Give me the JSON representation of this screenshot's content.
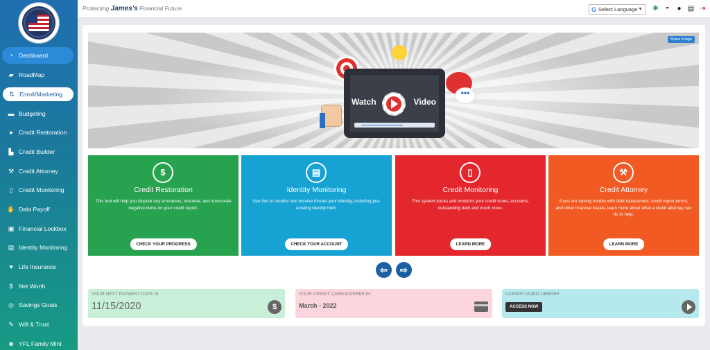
{
  "header": {
    "tagline_pre": "Protecting",
    "user_name": "James's",
    "tagline_post": "Financial Future.",
    "language_select": "Select Language"
  },
  "sidebar": {
    "items": [
      {
        "label": "Dashboard",
        "icon": "speedometer-icon"
      },
      {
        "label": "RoadMap",
        "icon": "car-icon"
      },
      {
        "label": "Enroll/Marketing",
        "icon": "share-icon"
      },
      {
        "label": "Budgeting",
        "icon": "wallet-icon"
      },
      {
        "label": "Credit Restoration",
        "icon": "money-hand-icon"
      },
      {
        "label": "Credit Builder",
        "icon": "building-icon"
      },
      {
        "label": "Credit Attorney",
        "icon": "gavel-icon"
      },
      {
        "label": "Credit Monitoring",
        "icon": "mobile-icon"
      },
      {
        "label": "Debt Payoff",
        "icon": "hand-cash-icon"
      },
      {
        "label": "Financial Lockbox",
        "icon": "lockbox-icon"
      },
      {
        "label": "Identity Monitoring",
        "icon": "id-card-icon"
      },
      {
        "label": "Life Insurance",
        "icon": "heart-pulse-icon"
      },
      {
        "label": "Net Worth",
        "icon": "money-bag-icon"
      },
      {
        "label": "Savings Goals",
        "icon": "coins-icon"
      },
      {
        "label": "Will & Trust",
        "icon": "handshake-icon"
      },
      {
        "label": "YFL Family Mint",
        "icon": "family-icon"
      }
    ]
  },
  "banner": {
    "share_label": "Share Image",
    "watch_text": "Watch",
    "video_text": "Video"
  },
  "cards": [
    {
      "title": "Credit Restoration",
      "desc": "This tool will help you dispute any erroneous, obsolete, and inaccurate negative items on your credit report.",
      "button": "CHECK YOUR PROGRESS",
      "color": "#27a24f",
      "icon": "money-hand-icon"
    },
    {
      "title": "Identity Monitoring",
      "desc": "Use this to monitor and resolve threats your identity, including pre-existing identity theft.",
      "button": "CHECK YOUR ACCOUNT",
      "color": "#17a2d4",
      "icon": "id-card-icon"
    },
    {
      "title": "Credit Monitoring",
      "desc": "This system tracks and monitors your credit score, accounts, outstanding debt and much more.",
      "button": "LEARN MORE",
      "color": "#e3272d",
      "icon": "mobile-icon"
    },
    {
      "title": "Credit Attorney",
      "desc": "If you are having trouble with debt harassment, credit report errors, and other financial issues, learn more about what a credit attorney can do to help.",
      "button": "LEARN MORE",
      "color": "#f15a22",
      "icon": "gavel-icon"
    }
  ],
  "info": {
    "payment_label": "YOUR NEXT PAYMENT DATE IS",
    "payment_date": "11/15/2020",
    "card_label": "YOUR CREDIT CARD EXPIRES IN:",
    "card_expiry": "March - 2022",
    "library_label": "UCESPP VIDEO LIBRARY",
    "access_button": "ACCESS NOW"
  }
}
